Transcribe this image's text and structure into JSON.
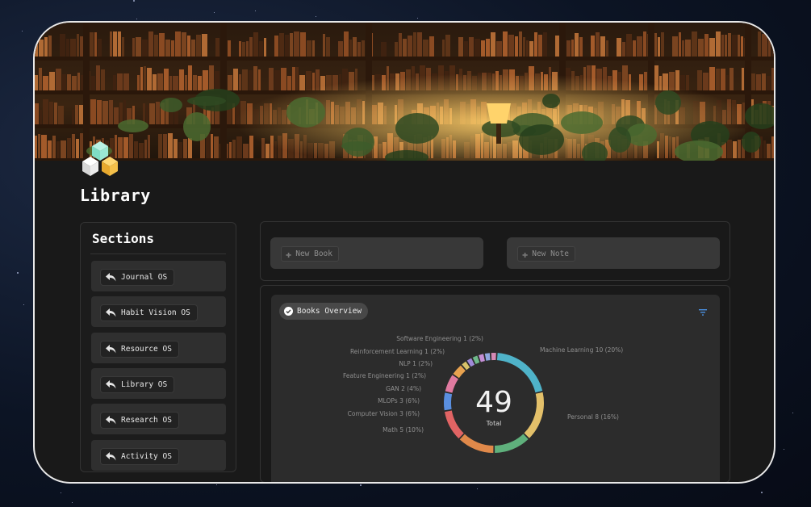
{
  "page": {
    "title": "Library"
  },
  "sections": {
    "title": "Sections",
    "items": [
      {
        "label": "Journal OS"
      },
      {
        "label": "Habit Vision OS"
      },
      {
        "label": "Resource OS"
      },
      {
        "label": "Library OS"
      },
      {
        "label": "Research OS"
      },
      {
        "label": "Activity OS"
      }
    ]
  },
  "actions": {
    "new_book": "New Book",
    "new_note": "New Note"
  },
  "overview": {
    "tab_label": "Books Overview"
  },
  "chart_data": {
    "type": "pie",
    "variant": "donut",
    "total_value": "49",
    "total_label": "Total",
    "slices": [
      {
        "label": "Machine Learning 10 (20%)",
        "value": 10,
        "color": "#4fb3c9"
      },
      {
        "label": "Personal 8 (16%)",
        "value": 8,
        "color": "#e3c06a"
      },
      {
        "label": "",
        "value": 6,
        "color": "#5fb07c"
      },
      {
        "label": "",
        "value": 6,
        "color": "#e0894a"
      },
      {
        "label": "Math 5 (10%)",
        "value": 5,
        "color": "#e06464"
      },
      {
        "label": "Computer Vision 3 (6%)",
        "value": 3,
        "color": "#5a8fe0"
      },
      {
        "label": "MLOPs 3 (6%)",
        "value": 3,
        "color": "#e07aa0"
      },
      {
        "label": "GAN 2 (4%)",
        "value": 2,
        "color": "#e8a24f"
      },
      {
        "label": "Feature Engineering 1 (2%)",
        "value": 1,
        "color": "#d9c36a"
      },
      {
        "label": "NLP 1 (2%)",
        "value": 1,
        "color": "#a08ad8"
      },
      {
        "label": "Reinforcement Learning 1 (2%)",
        "value": 1,
        "color": "#6fb88a"
      },
      {
        "label": "Software Engineering 1 (2%)",
        "value": 1,
        "color": "#c58fd6"
      },
      {
        "label": "",
        "value": 1,
        "color": "#8fa8e0"
      },
      {
        "label": "",
        "value": 1,
        "color": "#d58ab5"
      }
    ]
  },
  "colors": {
    "background": "#191919",
    "card": "#2f2f2f",
    "accent": "#4a8fe0"
  },
  "icons": {
    "logo": "cubes-icon",
    "section_item": "return-arrow-icon",
    "action": "plus-icon",
    "tab": "checkmark-circle-icon",
    "filter": "filter-icon"
  }
}
